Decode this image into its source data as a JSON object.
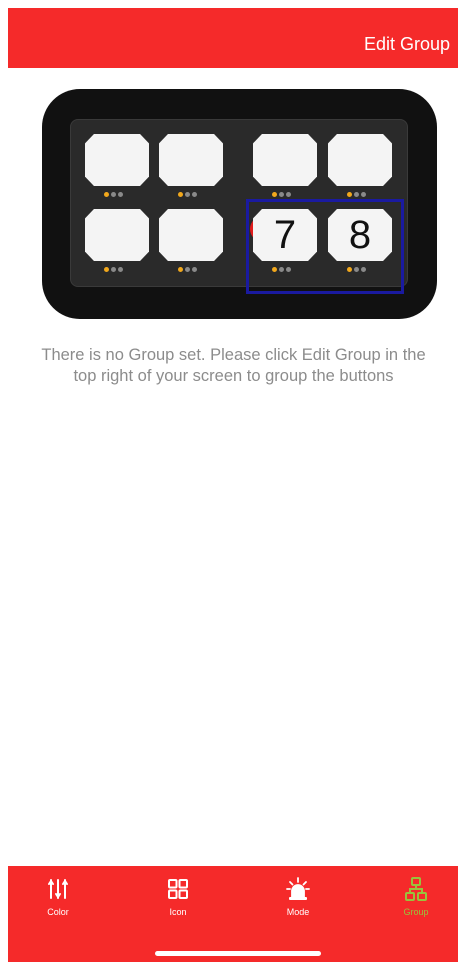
{
  "header": {
    "action_label": "Edit Group"
  },
  "keypad": {
    "keys": [
      {
        "label": ""
      },
      {
        "label": ""
      },
      {
        "label": ""
      },
      {
        "label": ""
      },
      {
        "label": ""
      },
      {
        "label": ""
      },
      {
        "label": "7"
      },
      {
        "label": "8"
      }
    ]
  },
  "message": "There is no Group set. Please click Edit Group in the top right of your screen to group the buttons",
  "tabs": [
    {
      "label": "Color",
      "icon": "sliders-icon",
      "active": false
    },
    {
      "label": "Icon",
      "icon": "grid-icon",
      "active": false
    },
    {
      "label": "Mode",
      "icon": "siren-icon",
      "active": false
    },
    {
      "label": "Group",
      "icon": "group-icon",
      "active": true
    }
  ],
  "colors": {
    "brand_red": "#f52a2a",
    "active_tab": "#9ac23c",
    "led_on": "#f2a81c",
    "highlight": "#1a1aa0"
  }
}
